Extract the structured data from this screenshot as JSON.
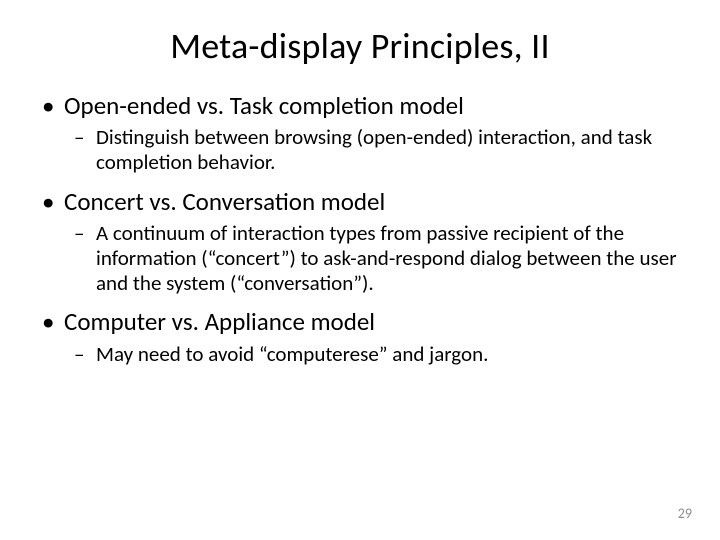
{
  "title": "Meta-display Principles, II",
  "items": [
    {
      "heading": "Open-ended vs. Task completion model",
      "sub": "Distinguish between browsing (open-ended) interaction, and task completion behavior."
    },
    {
      "heading": "Concert vs. Conversation model",
      "sub": "A continuum of interaction types from passive recipient of the information (“concert”) to ask-and-respond dialog between the user and the system (“conversation”)."
    },
    {
      "heading": "Computer vs. Appliance model",
      "sub": "May need to avoid “computerese” and jargon."
    }
  ],
  "page_number": "29"
}
